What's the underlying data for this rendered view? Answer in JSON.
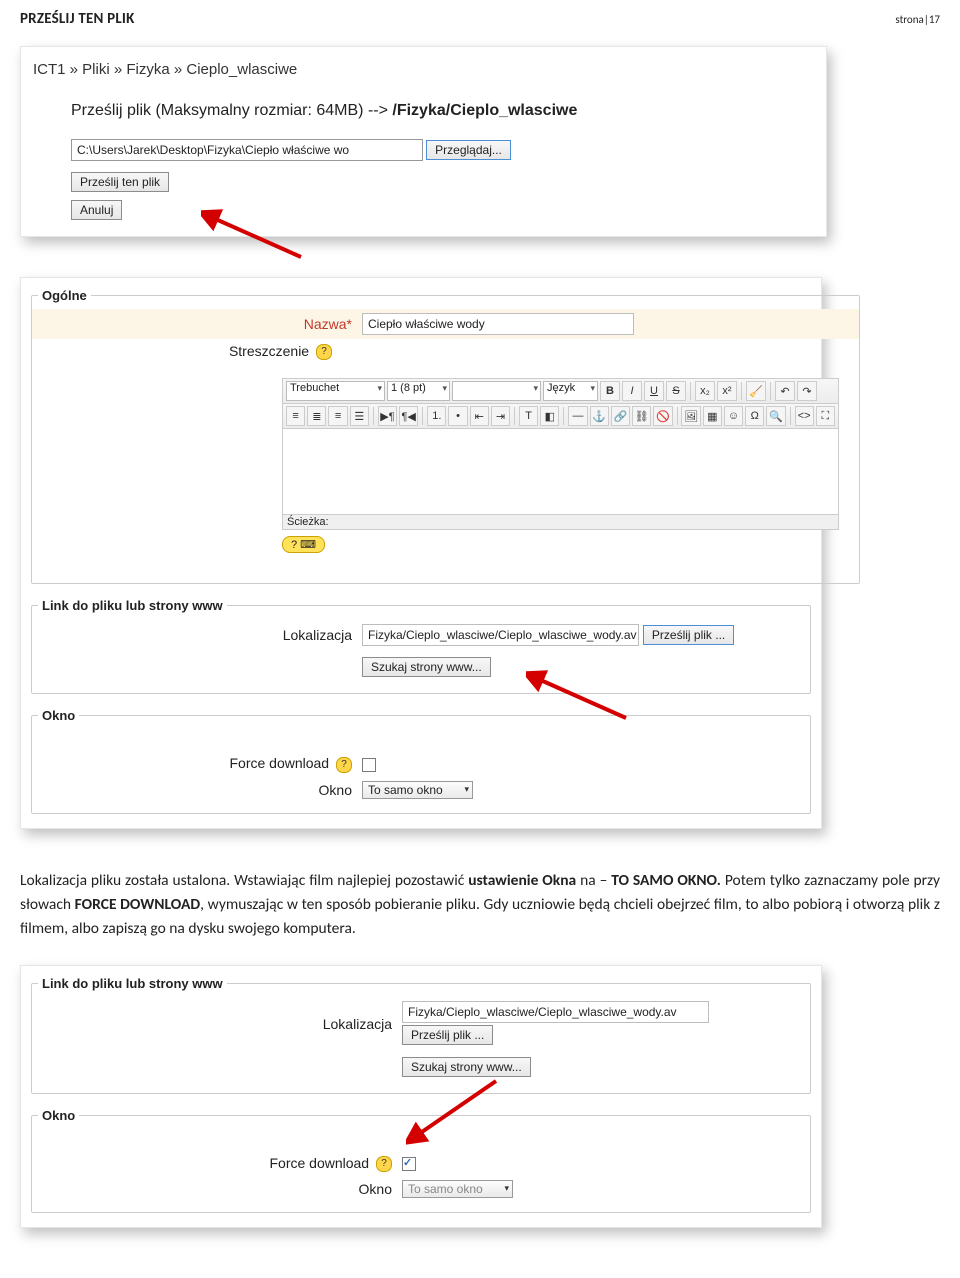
{
  "header": {
    "title": "PRZEŚLIJ TEN PLIK",
    "page_num": "strona|17"
  },
  "panel1": {
    "breadcrumb": "ICT1 » Pliki » Fizyka » Cieplo_wlasciwe",
    "upload_prefix": "Prześlij plik (Maksymalny rozmiar: 64MB) --> ",
    "upload_path": "/Fizyka/Cieplo_wlasciwe",
    "file_value": "C:\\Users\\Jarek\\Desktop\\Fizyka\\Ciepło właściwe wo",
    "browse_btn": "Przeglądaj...",
    "send_btn": "Prześlij ten plik",
    "cancel_btn": "Anuluj"
  },
  "panel2": {
    "fieldset_general": "Ogólne",
    "name_label": "Nazwa*",
    "name_value": "Ciepło właściwe wody",
    "summary_label": "Streszczenie",
    "editor": {
      "font_sel": "Trebuchet",
      "size_sel": "1 (8 pt)",
      "style_sel": "",
      "lang_sel": "Język",
      "path_label": "Ścieżka:"
    },
    "fieldset_link": "Link do pliku lub strony www",
    "location_label": "Lokalizacja",
    "location_value": "Fizyka/Cieplo_wlasciwe/Cieplo_wlasciwe_wody.av",
    "upload_btn": "Prześlij plik ...",
    "search_btn": "Szukaj strony www...",
    "fieldset_window": "Okno",
    "force_dl_label": "Force download",
    "window_label": "Okno",
    "window_value": "To samo okno"
  },
  "body": {
    "t1": "Lokalizacja pliku została ustalona. Wstawiając film najlepiej pozostawić ",
    "b1": "ustawienie Okna",
    "t2": " na – ",
    "b2": "TO SAMO OKNO.",
    "t3": " Potem tylko zaznaczamy pole przy słowach ",
    "b3": "FORCE DOWNLOAD",
    "t4": ", wymuszając w ten sposób pobieranie pliku. Gdy uczniowie będą chcieli obejrzeć film, to albo pobiorą i otworzą plik z filmem, albo zapiszą go na dysku swojego komputera."
  },
  "panel3": {
    "fieldset_link": "Link do pliku lub strony www",
    "location_label": "Lokalizacja",
    "location_value": "Fizyka/Cieplo_wlasciwe/Cieplo_wlasciwe_wody.av",
    "upload_btn": "Prześlij plik ...",
    "search_btn": "Szukaj strony www...",
    "fieldset_window": "Okno",
    "force_dl_label": "Force download",
    "window_label": "Okno",
    "window_value": "To samo okno"
  }
}
